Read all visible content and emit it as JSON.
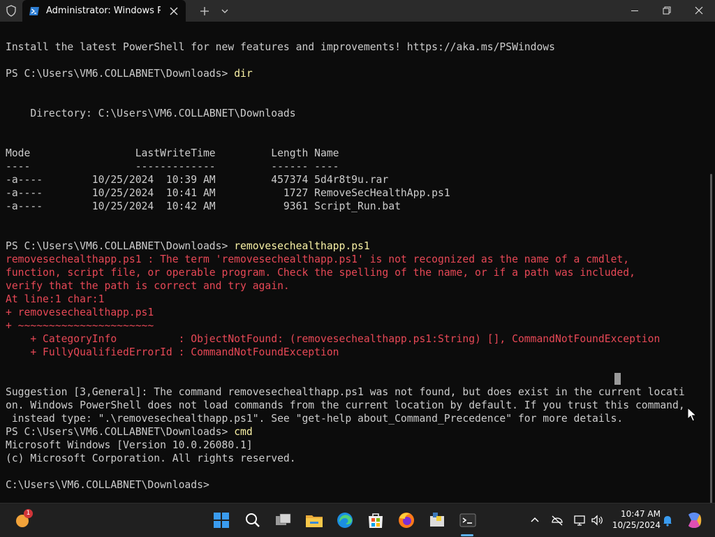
{
  "window": {
    "tab_title": "Administrator: Windows PowerShell"
  },
  "terminal": {
    "lines": [
      {
        "parts": [
          {
            "t": "Install the latest PowerShell for new features and improvements! https://aka.ms/PSWindows",
            "c": ""
          }
        ]
      },
      {
        "parts": [
          {
            "t": "",
            "c": ""
          }
        ]
      },
      {
        "parts": [
          {
            "t": "PS C:\\Users\\VM6.COLLABNET\\Downloads> ",
            "c": ""
          },
          {
            "t": "dir",
            "c": "cmd"
          }
        ]
      },
      {
        "parts": [
          {
            "t": "",
            "c": ""
          }
        ]
      },
      {
        "parts": [
          {
            "t": "",
            "c": ""
          }
        ]
      },
      {
        "parts": [
          {
            "t": "    Directory: C:\\Users\\VM6.COLLABNET\\Downloads",
            "c": ""
          }
        ]
      },
      {
        "parts": [
          {
            "t": "",
            "c": ""
          }
        ]
      },
      {
        "parts": [
          {
            "t": "",
            "c": ""
          }
        ]
      },
      {
        "parts": [
          {
            "t": "Mode                 LastWriteTime         Length Name",
            "c": ""
          }
        ]
      },
      {
        "parts": [
          {
            "t": "----                 -------------         ------ ----",
            "c": ""
          }
        ]
      },
      {
        "parts": [
          {
            "t": "-a----        10/25/2024  10:39 AM         457374 5d4r8t9u.rar",
            "c": ""
          }
        ]
      },
      {
        "parts": [
          {
            "t": "-a----        10/25/2024  10:41 AM           1727 RemoveSecHealthApp.ps1",
            "c": ""
          }
        ]
      },
      {
        "parts": [
          {
            "t": "-a----        10/25/2024  10:42 AM           9361 Script_Run.bat",
            "c": ""
          }
        ]
      },
      {
        "parts": [
          {
            "t": "",
            "c": ""
          }
        ]
      },
      {
        "parts": [
          {
            "t": "",
            "c": ""
          }
        ]
      },
      {
        "parts": [
          {
            "t": "PS C:\\Users\\VM6.COLLABNET\\Downloads> ",
            "c": ""
          },
          {
            "t": "removesechealthapp.ps1",
            "c": "cmd"
          }
        ]
      },
      {
        "parts": [
          {
            "t": "removesechealthapp.ps1 : The term 'removesechealthapp.ps1' is not recognized as the name of a cmdlet,",
            "c": "err"
          }
        ]
      },
      {
        "parts": [
          {
            "t": "function, script file, or operable program. Check the spelling of the name, or if a path was included,",
            "c": "err"
          }
        ]
      },
      {
        "parts": [
          {
            "t": "verify that the path is correct and try again.",
            "c": "err"
          }
        ]
      },
      {
        "parts": [
          {
            "t": "At line:1 char:1",
            "c": "err"
          }
        ]
      },
      {
        "parts": [
          {
            "t": "+ removesechealthapp.ps1",
            "c": "err"
          }
        ]
      },
      {
        "parts": [
          {
            "t": "+ ~~~~~~~~~~~~~~~~~~~~~~",
            "c": "err"
          }
        ]
      },
      {
        "parts": [
          {
            "t": "    + CategoryInfo          : ObjectNotFound: (removesechealthapp.ps1:String) [], CommandNotFoundException",
            "c": "err"
          }
        ]
      },
      {
        "parts": [
          {
            "t": "    + FullyQualifiedErrorId : CommandNotFoundException",
            "c": "err"
          }
        ]
      },
      {
        "parts": [
          {
            "t": "",
            "c": ""
          }
        ]
      },
      {
        "parts": [
          {
            "t": "",
            "c": ""
          }
        ]
      },
      {
        "parts": [
          {
            "t": "Suggestion [3,General]: The command removesechealthapp.ps1 was not found, but does exist in the current locati",
            "c": ""
          }
        ]
      },
      {
        "parts": [
          {
            "t": "on. Windows PowerShell does not load commands from the current location by default. If you trust this command,",
            "c": ""
          }
        ]
      },
      {
        "parts": [
          {
            "t": " instead type: \".\\removesechealthapp.ps1\". See \"get-help about_Command_Precedence\" for more details.",
            "c": ""
          }
        ]
      },
      {
        "parts": [
          {
            "t": "PS C:\\Users\\VM6.COLLABNET\\Downloads> ",
            "c": ""
          },
          {
            "t": "cmd",
            "c": "cmd"
          }
        ]
      },
      {
        "parts": [
          {
            "t": "Microsoft Windows [Version 10.0.26080.1]",
            "c": ""
          }
        ]
      },
      {
        "parts": [
          {
            "t": "(c) Microsoft Corporation. All rights reserved.",
            "c": ""
          }
        ]
      },
      {
        "parts": [
          {
            "t": "",
            "c": ""
          }
        ]
      },
      {
        "parts": [
          {
            "t": "C:\\Users\\VM6.COLLABNET\\Downloads>",
            "c": ""
          }
        ]
      }
    ]
  },
  "taskbar": {
    "widget_badge": "1",
    "clock_time": "10:47 AM",
    "clock_date": "10/25/2024",
    "icons": [
      "weather-widget-icon",
      "start-icon",
      "search-icon",
      "task-view-icon",
      "file-explorer-icon",
      "edge-icon",
      "store-icon",
      "firefox-icon",
      "python-idle-icon",
      "terminal-icon"
    ]
  },
  "colors": {
    "terminal_bg": "#0c0c0c",
    "text": "#cccccc",
    "command": "#f9f1a5",
    "error": "#e74856",
    "titlebar": "#2b2b2b",
    "taskbar": "#202020"
  }
}
